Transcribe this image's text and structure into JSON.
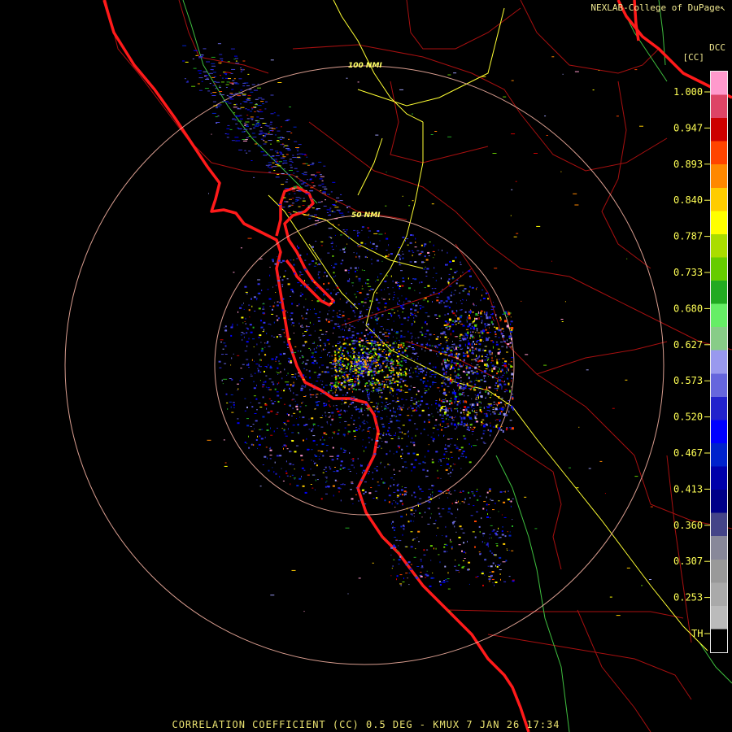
{
  "header": {
    "credit": "NEXLAB-College of DuPage",
    "credit_mark": "↖"
  },
  "product_title": "CORRELATION COEFFICIENT (CC) 0.5 DEG - KMUX 7 JAN 26 17:34",
  "scale": {
    "code": "DCC",
    "unit": "[CC]",
    "ticks": [
      "1.000",
      "0.947",
      "0.893",
      "0.840",
      "0.787",
      "0.733",
      "0.680",
      "0.627",
      "0.573",
      "0.520",
      "0.467",
      "0.413",
      "0.360",
      "0.307",
      "0.253",
      "TH"
    ]
  },
  "range_rings": [
    {
      "label": "50 NMI",
      "nmi": 50
    },
    {
      "label": "100 NMI",
      "nmi": 100
    }
  ],
  "colors": {
    "background": "#000000",
    "coastline": "#ff1a1a",
    "county_lines": "#b01010",
    "highways": "#ffff33",
    "rivers": "#40c040",
    "range_rings": "#ffb0a0",
    "text": "#ffff55"
  },
  "colorbar_stops": [
    "#ff99cc",
    "#dd4466",
    "#cc0000",
    "#ff4400",
    "#ff8800",
    "#ffcc00",
    "#ffff00",
    "#aadd00",
    "#66cc00",
    "#22aa22",
    "#66ee66",
    "#88cc88",
    "#9999ee",
    "#6666dd",
    "#2222cc",
    "#0000ff",
    "#0022cc",
    "#0000aa",
    "#000088",
    "#444488",
    "#888899",
    "#999999",
    "#aaaaaa",
    "#bbbbbb",
    "#000000"
  ]
}
